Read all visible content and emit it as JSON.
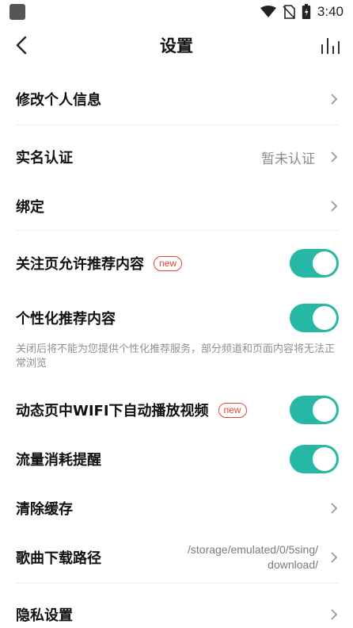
{
  "status_bar": {
    "time": "3:40"
  },
  "header": {
    "title": "设置"
  },
  "rows": {
    "edit_profile": "修改个人信息",
    "real_name": "实名认证",
    "real_name_status": "暂未认证",
    "bind": "绑定",
    "follow_recommend": "关注页允许推荐内容",
    "personalized": "个性化推荐内容",
    "personalized_note": "关闭后将不能为您提供个性化推荐服务，部分频道和页面内容将无法正常浏览",
    "autoplay_wifi": "动态页中WIFI下自动播放视频",
    "data_alert": "流量消耗提醒",
    "clear_cache": "清除缓存",
    "download_path": "歌曲下载路径",
    "download_path_line1": "/storage/emulated/0/5sing/",
    "download_path_line2": "download/",
    "privacy": "隐私设置"
  },
  "badges": {
    "new": "new"
  },
  "toggles": {
    "follow_recommend": true,
    "personalized": true,
    "autoplay_wifi": true,
    "data_alert": true
  },
  "colors": {
    "toggle_on": "#27b7a5",
    "badge": "#e2443c"
  },
  "icons": [
    "back-arrow-icon",
    "stats-icon",
    "chevron-right-icon",
    "wifi-icon",
    "no-sim-icon",
    "battery-icon"
  ]
}
